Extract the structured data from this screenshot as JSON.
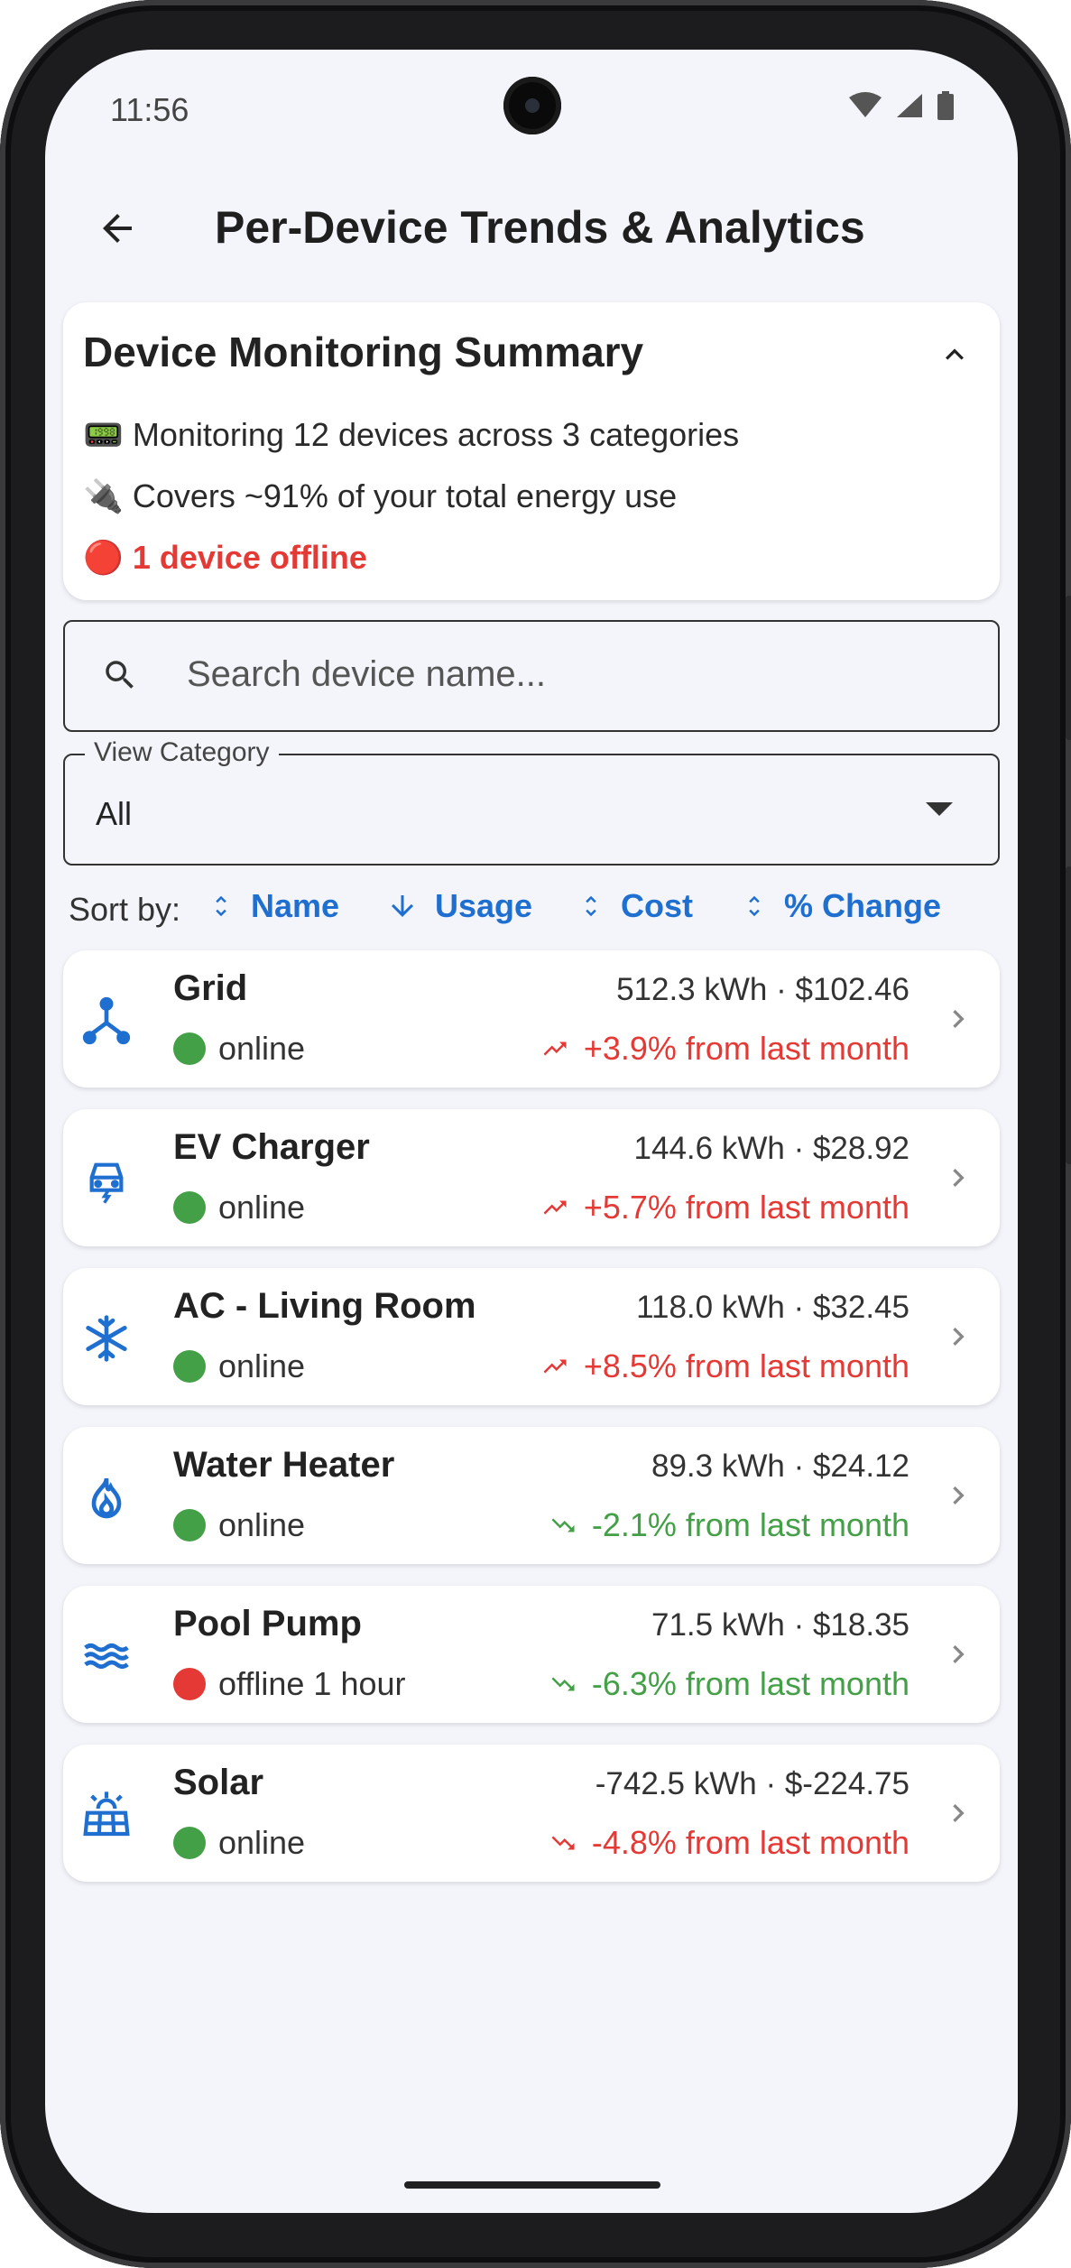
{
  "status_bar": {
    "time": "11:56"
  },
  "app_bar": {
    "title": "Per-Device Trends & Analytics"
  },
  "summary": {
    "title": "Device Monitoring Summary",
    "line1": "📟 Monitoring 12 devices across 3 categories",
    "line2": "🔌 Covers ~91% of your total energy use",
    "line3": "🔴 1 device offline"
  },
  "search": {
    "placeholder": "Search device name..."
  },
  "category": {
    "label": "View Category",
    "value": "All"
  },
  "sort": {
    "label": "Sort by:",
    "options": [
      "Name",
      "Usage",
      "Cost",
      "% Change"
    ]
  },
  "devices": [
    {
      "name": "Grid",
      "usage": "512.3 kWh · $102.46",
      "status": "online",
      "status_color": "#43a047",
      "change": "+3.9% from last month",
      "trend": "up",
      "icon": "grid-icon"
    },
    {
      "name": "EV Charger",
      "usage": "144.6 kWh · $28.92",
      "status": "online",
      "status_color": "#43a047",
      "change": "+5.7% from last month",
      "trend": "up",
      "icon": "ev-charger-icon"
    },
    {
      "name": "AC - Living Room",
      "usage": "118.0 kWh · $32.45",
      "status": "online",
      "status_color": "#43a047",
      "change": "+8.5% from last month",
      "trend": "up",
      "icon": "snowflake-icon"
    },
    {
      "name": "Water Heater",
      "usage": "89.3 kWh · $24.12",
      "status": "online",
      "status_color": "#43a047",
      "change": "-2.1% from last month",
      "trend": "down",
      "icon": "flame-icon"
    },
    {
      "name": "Pool Pump",
      "usage": "71.5 kWh · $18.35",
      "status": "offline 1 hour",
      "status_color": "#e53935",
      "change": "-6.3% from last month",
      "trend": "down",
      "icon": "waves-icon"
    },
    {
      "name": "Solar",
      "usage": "-742.5 kWh · $-224.75",
      "status": "online",
      "status_color": "#43a047",
      "change": "-4.8% from last month",
      "trend": "down-red",
      "icon": "solar-panel-icon"
    }
  ],
  "colors": {
    "accent": "#1e6fcf",
    "up": "#e53935",
    "down": "#43a047",
    "online": "#43a047",
    "offline": "#e53935"
  }
}
